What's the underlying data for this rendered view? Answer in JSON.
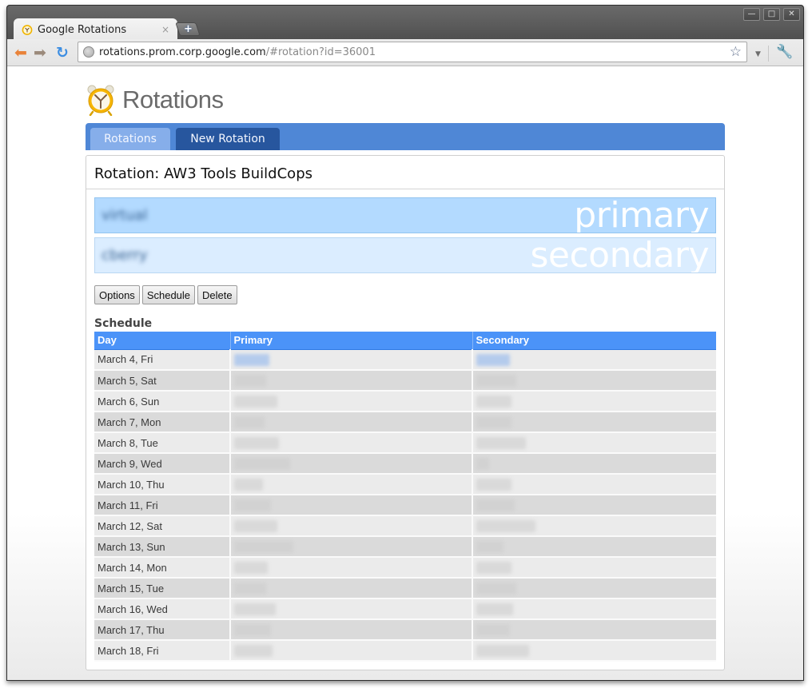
{
  "window": {
    "controls": [
      "minimize",
      "maximize",
      "close"
    ],
    "tab": {
      "title": "Google Rotations",
      "close_glyph": "×",
      "favicon": "alarm-clock-icon"
    },
    "new_tab_glyph": "+"
  },
  "toolbar": {
    "back_glyph": "⬅",
    "forward_glyph": "➡",
    "reload_glyph": "↻",
    "url_host": "rotations.prom.corp.google.com",
    "url_rest": "/#rotation?id=36001",
    "bookmark_glyph": "☆",
    "page_menu_glyph": "▼",
    "wrench_glyph": "🔧"
  },
  "app": {
    "logo_text": "Rotations",
    "nav_tabs": [
      {
        "label": "Rotations",
        "active": false
      },
      {
        "label": "New Rotation",
        "active": true
      }
    ],
    "rotation_title": "Rotation: AW3 Tools BuildCops",
    "oncall": {
      "primary": {
        "name": "virtual",
        "role_label": "primary",
        "redacted": true
      },
      "secondary": {
        "name": "cberry",
        "role_label": "secondary",
        "redacted": true
      }
    },
    "actions": {
      "options": "Options",
      "schedule": "Schedule",
      "delete": "Delete"
    },
    "schedule": {
      "heading": "Schedule",
      "columns": [
        "Day",
        "Primary",
        "Secondary"
      ],
      "rows": [
        {
          "day": "March 4, Fri",
          "primary": "[redacted]",
          "secondary": "[redacted]",
          "current": true
        },
        {
          "day": "March 5, Sat",
          "primary": "[redacted]",
          "secondary": "[redacted]"
        },
        {
          "day": "March 6, Sun",
          "primary": "[redacted]",
          "secondary": "[redacted]"
        },
        {
          "day": "March 7, Mon",
          "primary": "[redacted]",
          "secondary": "[redacted]"
        },
        {
          "day": "March 8, Tue",
          "primary": "[redacted]",
          "secondary": "[redacted]"
        },
        {
          "day": "March 9, Wed",
          "primary": "[redacted]",
          "secondary": "[redacted]"
        },
        {
          "day": "March 10, Thu",
          "primary": "[redacted]",
          "secondary": "[redacted]"
        },
        {
          "day": "March 11, Fri",
          "primary": "[redacted]",
          "secondary": "[redacted]"
        },
        {
          "day": "March 12, Sat",
          "primary": "[redacted]",
          "secondary": "[redacted]"
        },
        {
          "day": "March 13, Sun",
          "primary": "[redacted]",
          "secondary": "[redacted]"
        },
        {
          "day": "March 14, Mon",
          "primary": "[redacted]",
          "secondary": "[redacted]"
        },
        {
          "day": "March 15, Tue",
          "primary": "[redacted]",
          "secondary": "[redacted]"
        },
        {
          "day": "March 16, Wed",
          "primary": "[redacted]",
          "secondary": "[redacted]"
        },
        {
          "day": "March 17, Thu",
          "primary": "[redacted]",
          "secondary": "[redacted]"
        },
        {
          "day": "March 18, Fri",
          "primary": "[redacted]",
          "secondary": "[redacted]"
        }
      ]
    }
  },
  "colors": {
    "tabbar": "#4f87d6",
    "tab_inactive": "#86aeea",
    "tab_active": "#27569e",
    "primary_banner": "#b3daff",
    "secondary_banner": "#dbedff",
    "table_header": "#4b93f8",
    "row_odd": "#ebebeb",
    "row_even": "#dadada"
  }
}
